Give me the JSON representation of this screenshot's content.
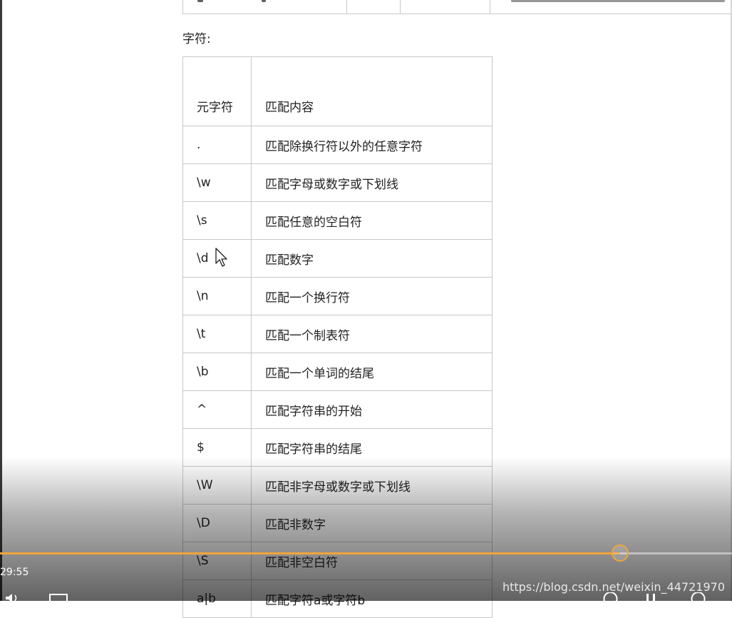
{
  "section_label": "字符:",
  "table": {
    "headers": [
      "元字符",
      "匹配内容"
    ],
    "rows": [
      [
        ".",
        "匹配除换行符以外的任意字符"
      ],
      [
        "\\w",
        "匹配字母或数字或下划线"
      ],
      [
        "\\s",
        "匹配任意的空白符"
      ],
      [
        "\\d",
        "匹配数字"
      ],
      [
        "\\n",
        "匹配一个换行符"
      ],
      [
        "\\t",
        "匹配一个制表符"
      ],
      [
        "\\b",
        "匹配一个单词的结尾"
      ],
      [
        "^",
        "匹配字符串的开始"
      ],
      [
        "$",
        "匹配字符串的结尾"
      ],
      [
        "\\W",
        "匹配非字母或数字或下划线"
      ],
      [
        "\\D",
        "匹配非数字"
      ],
      [
        "\\S",
        "匹配非空白符"
      ],
      [
        "a|b",
        "匹配字符a或字符b"
      ]
    ]
  },
  "player": {
    "time": "29:55",
    "progress_fraction": 0.847,
    "accent_color": "#f0a53a",
    "watermark": "https://blog.csdn.net/weixin_44721970",
    "icons": [
      "volume-icon",
      "fullscreen-icon",
      "rewind-icon",
      "pause-icon",
      "forward-icon"
    ]
  }
}
